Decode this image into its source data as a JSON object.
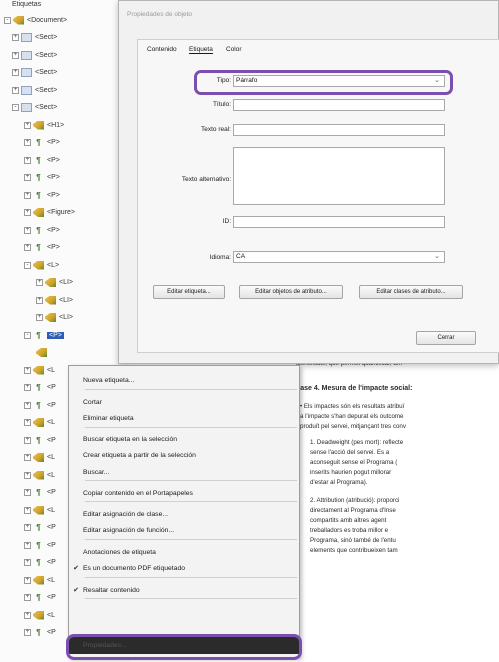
{
  "tree": {
    "title": "Etiquetas",
    "rows": [
      {
        "label": "<Document>",
        "icon": "document-tag-icon",
        "exp": "-"
      },
      {
        "label": "<Sect>",
        "icon": "section-tag-icon",
        "exp": "+"
      },
      {
        "label": "<Sect>",
        "icon": "section-tag-icon",
        "exp": "+"
      },
      {
        "label": "<Sect>",
        "icon": "section-tag-icon",
        "exp": "+"
      },
      {
        "label": "<Sect>",
        "icon": "section-tag-icon",
        "exp": "+"
      },
      {
        "label": "<Sect>",
        "icon": "section-tag-icon",
        "exp": "-"
      },
      {
        "label": "<H1>",
        "icon": "structure-tag-icon",
        "exp": "+"
      },
      {
        "label": "<P>",
        "icon": "paragraph-tag-icon",
        "exp": "+"
      },
      {
        "label": "<P>",
        "icon": "paragraph-tag-icon",
        "exp": "+"
      },
      {
        "label": "<P>",
        "icon": "paragraph-tag-icon",
        "exp": "+"
      },
      {
        "label": "<P>",
        "icon": "paragraph-tag-icon",
        "exp": "+"
      },
      {
        "label": "<Figure>",
        "icon": "structure-tag-icon",
        "exp": "+"
      },
      {
        "label": "<P>",
        "icon": "paragraph-tag-icon",
        "exp": "+"
      },
      {
        "label": "<P>",
        "icon": "paragraph-tag-icon",
        "exp": "+"
      },
      {
        "label": "<L>",
        "icon": "structure-tag-icon",
        "exp": "-"
      },
      {
        "label": "<LI>",
        "icon": "structure-tag-icon",
        "exp": "+"
      },
      {
        "label": "<LI>",
        "icon": "structure-tag-icon",
        "exp": "+"
      },
      {
        "label": "<LI>",
        "icon": "structure-tag-icon",
        "exp": "+"
      },
      {
        "label": "<P>",
        "icon": "paragraph-tag-icon",
        "exp": "-"
      },
      {
        "label": "",
        "icon": "structure-tag-icon",
        "exp": ""
      },
      {
        "label": "<L",
        "icon": "structure-tag-icon",
        "exp": "+"
      },
      {
        "label": "<P",
        "icon": "paragraph-tag-icon",
        "exp": "+"
      },
      {
        "label": "<P",
        "icon": "paragraph-tag-icon",
        "exp": "+"
      },
      {
        "label": "<L",
        "icon": "structure-tag-icon",
        "exp": "+"
      },
      {
        "label": "<P",
        "icon": "paragraph-tag-icon",
        "exp": "+"
      },
      {
        "label": "<L",
        "icon": "structure-tag-icon",
        "exp": "+"
      },
      {
        "label": "<L",
        "icon": "structure-tag-icon",
        "exp": "+"
      },
      {
        "label": "<P",
        "icon": "paragraph-tag-icon",
        "exp": "+"
      },
      {
        "label": "<L",
        "icon": "structure-tag-icon",
        "exp": "+"
      },
      {
        "label": "<P",
        "icon": "paragraph-tag-icon",
        "exp": "+"
      },
      {
        "label": "<P",
        "icon": "paragraph-tag-icon",
        "exp": "+"
      },
      {
        "label": "<P",
        "icon": "paragraph-tag-icon",
        "exp": "+"
      },
      {
        "label": "<L",
        "icon": "structure-tag-icon",
        "exp": "+"
      },
      {
        "label": "<P",
        "icon": "paragraph-tag-icon",
        "exp": "+"
      },
      {
        "label": "<L",
        "icon": "structure-tag-icon",
        "exp": "+"
      },
      {
        "label": "<P",
        "icon": "paragraph-tag-icon",
        "exp": "+"
      }
    ],
    "selected_label": "<P>"
  },
  "dialog": {
    "title": "Propiedades de objeto",
    "tabs": [
      "Contenido",
      "Etiqueta",
      "Color"
    ],
    "active_tab": "Etiqueta",
    "fields": {
      "tipo_label": "Tipo:",
      "tipo_value": "Párrafo",
      "titulo_label": "Título:",
      "titulo_value": "",
      "texto_real_label": "Texto real:",
      "texto_real_value": "",
      "texto_alt_label": "Texto alternativo:",
      "texto_alt_value": "",
      "id_label": "ID:",
      "id_value": "",
      "idioma_label": "Idioma:",
      "idioma_value": "CA"
    },
    "buttons": {
      "edit_tag": "Editar etiqueta...",
      "edit_attr": "Editar objetos de atributo...",
      "edit_class": "Editar clases de atributo...",
      "close": "Cerrar"
    },
    "highlight_color": "#7a4fb0"
  },
  "menu": {
    "items": [
      {
        "label": "Nueva etiqueta...",
        "checked": false
      },
      {
        "label": "Cortar",
        "checked": false
      },
      {
        "label": "Eliminar etiqueta",
        "checked": false
      },
      {
        "label": "Buscar etiqueta en la selección",
        "checked": false
      },
      {
        "label": "Crear etiqueta a partir de la selección",
        "checked": false
      },
      {
        "label": "Buscar...",
        "checked": false
      },
      {
        "label": "Copiar contenido en el Portapapeles",
        "checked": false
      },
      {
        "label": "Editar asignación de clase...",
        "checked": false
      },
      {
        "label": "Editar asignación de función...",
        "checked": false
      },
      {
        "label": "Anotaciones de etiqueta",
        "checked": false
      },
      {
        "label": "Es un documento PDF etiquetado",
        "checked": true
      },
      {
        "label": "Resaltar contenido",
        "checked": true
      },
      {
        "label": "Propiedades...",
        "checked": false
      }
    ]
  },
  "doc": {
    "line1": "identificats, que permet quantificar, am",
    "heading": "Fase 4. Mesura de l'impacte social:",
    "bullet_lines": [
      "• Els impactes són els resultats atribuï",
      "a l'impacte s'han depurat els outcome",
      "produït pel servei, mitjançant tres conv"
    ],
    "list1_lines": [
      "1.  Deadweight (pes mort): reflecte",
      "     sense l'acció del servei. Es a",
      "     aconseguit sense el Programa (",
      "     inserits haurien pogut millorar",
      "     d'estar al Programa)."
    ],
    "list2_lines": [
      "2.  Attribution (atribució): proporci",
      "     directament al Programa d'Inse",
      "     compartits amb altres agent",
      "     treballadors es troba millor e",
      "     Programa, sinó també de l'entu",
      "     elements que contribueixen tam"
    ]
  }
}
